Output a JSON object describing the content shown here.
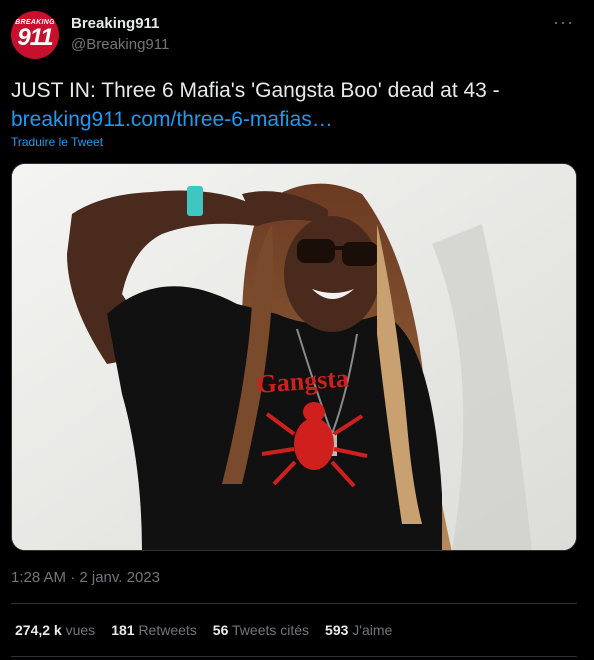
{
  "author": {
    "display_name": "Breaking911",
    "handle": "@Breaking911",
    "avatar_top_text": "BREAKING",
    "avatar_main_text": "911"
  },
  "more_icon": "more-horizontal-icon",
  "tweet": {
    "text": "JUST IN: Three 6 Mafia's 'Gangsta Boo' dead at 43 -",
    "link_text": "breaking911.com/three-6-mafias…",
    "translate_label": "Traduire le Tweet"
  },
  "timestamp": "1:28 AM · 2 janv. 2023",
  "stats": {
    "views": {
      "value": "274,2 k",
      "label": "vues"
    },
    "retweets": {
      "value": "181",
      "label": "Retweets"
    },
    "quotes": {
      "value": "56",
      "label": "Tweets cités"
    },
    "likes": {
      "value": "593",
      "label": "J'aime"
    }
  },
  "colors": {
    "background": "#000000",
    "text_primary": "#e7e9ea",
    "text_secondary": "#71767b",
    "link": "#1d9bf0",
    "avatar_red": "#c8102e",
    "divider": "#2f3336"
  }
}
